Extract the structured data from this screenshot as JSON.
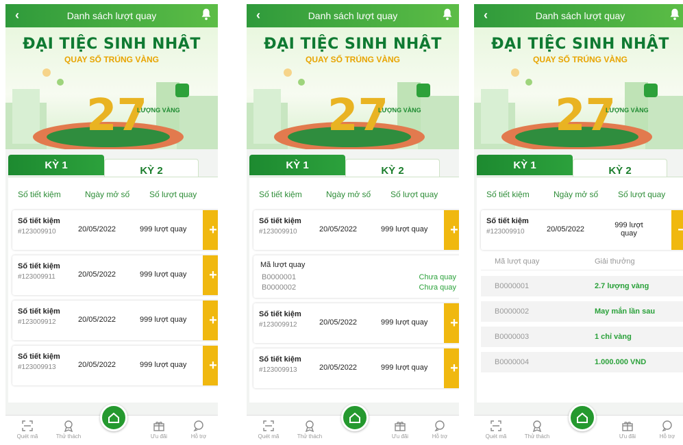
{
  "header": {
    "title": "Danh sách lượt quay"
  },
  "banner": {
    "title": "ĐẠI TIỆC SINH NHẬT",
    "subtitle": "QUAY SỐ TRÚNG VÀNG",
    "big_number": "27",
    "number_label": "LƯỢNG VÀNG"
  },
  "tabs": {
    "tab1": "KỲ 1",
    "tab2": "KỲ 2"
  },
  "columns": {
    "account": "Số tiết kiệm",
    "date": "Ngày mở số",
    "spins": "Số lượt quay"
  },
  "rows": [
    {
      "label": "Số tiết kiệm",
      "account": "#123009910",
      "date": "20/05/2022",
      "spins": "999 lượt quay"
    },
    {
      "label": "Số tiết kiệm",
      "account": "#123009911",
      "date": "20/05/2022",
      "spins": "999 lượt quay"
    },
    {
      "label": "Số tiết kiệm",
      "account": "#123009912",
      "date": "20/05/2022",
      "spins": "999 lượt quay"
    },
    {
      "label": "Số tiết kiệm",
      "account": "#123009913",
      "date": "20/05/2022",
      "spins": "999 lượt quay"
    }
  ],
  "expanded_codes": {
    "title": "Mã lượt quay",
    "items": [
      {
        "code": "B0000001",
        "status": "Chưa quay"
      },
      {
        "code": "B0000002",
        "status": "Chưa quay"
      }
    ]
  },
  "history": {
    "col_code": "Mã lượt quay",
    "col_prize": "Giải thưởng",
    "items": [
      {
        "code": "B0000001",
        "prize": "2.7 lượng vàng"
      },
      {
        "code": "B0000002",
        "prize": "May mắn lần sau"
      },
      {
        "code": "B0000003",
        "prize": "1 chỉ vàng"
      },
      {
        "code": "B0000004",
        "prize": "1.000.000 VND"
      }
    ],
    "expanded_spins": "999 lượt quay"
  },
  "bottom_nav": {
    "scan": "Quét mã",
    "challenge": "Thử thách",
    "offers": "Ưu đãi",
    "support": "Hỗ trợ"
  },
  "symbols": {
    "plus": "+",
    "minus": "−"
  },
  "colors": {
    "primary_green": "#25992f",
    "accent_yellow": "#f0b80f",
    "prize_green": "#2aa13a"
  }
}
